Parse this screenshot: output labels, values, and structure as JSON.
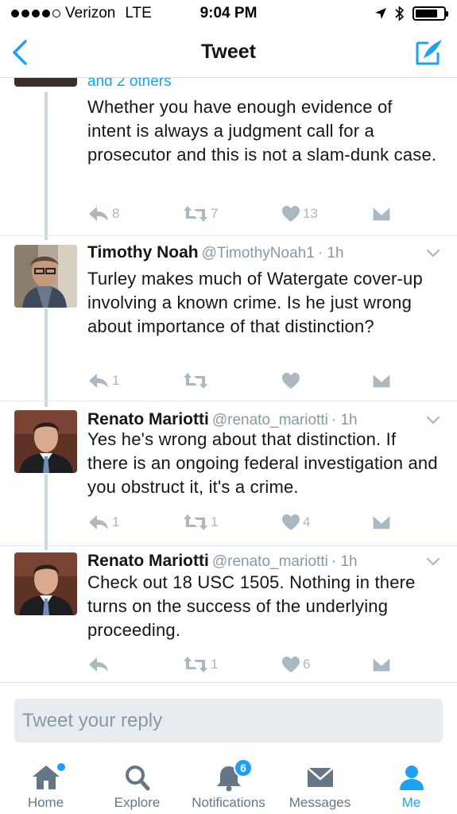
{
  "status_bar": {
    "carrier": "Verizon",
    "network": "LTE",
    "time": "9:04 PM"
  },
  "nav": {
    "title": "Tweet"
  },
  "tweets": [
    {
      "partial_header": "and 2 others",
      "text": "Whether you have enough evidence of intent is always a judgment call for a prosecutor and this is not a slam-dunk case.",
      "replies": "8",
      "retweets": "7",
      "likes": "13"
    },
    {
      "name": "Timothy Noah",
      "handle": "@TimothyNoah1",
      "time": "· 1h",
      "text": "Turley makes much of Watergate cover-up involving a known crime. Is he just wrong about importance of that distinction?",
      "replies": "1",
      "retweets": "",
      "likes": ""
    },
    {
      "name": "Renato Mariotti",
      "handle": "@renato_mariotti",
      "time": "· 1h",
      "text": "Yes he's wrong about that distinction.  If there is an ongoing federal investigation and you obstruct it, it's a crime.",
      "replies": "1",
      "retweets": "1",
      "likes": "4"
    },
    {
      "name": "Renato Mariotti",
      "handle": "@renato_mariotti",
      "time": "· 1h",
      "text": "Check out 18 USC 1505.  Nothing in there turns on the success of the underlying proceeding.",
      "replies": "",
      "retweets": "1",
      "likes": "6"
    }
  ],
  "reply": {
    "placeholder": "Tweet your reply"
  },
  "tabs": [
    {
      "label": "Home"
    },
    {
      "label": "Explore"
    },
    {
      "label": "Notifications",
      "badge": "6"
    },
    {
      "label": "Messages"
    },
    {
      "label": "Me"
    }
  ],
  "colors": {
    "accent": "#1da1f2",
    "icon_gray": "#aab8c2",
    "thread_line": "#ccd6dd"
  }
}
